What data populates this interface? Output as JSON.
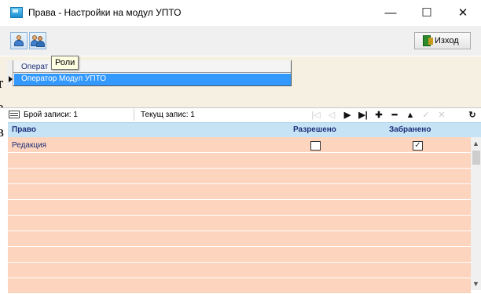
{
  "window": {
    "title": "Права - Настройки на модул УПТО",
    "minimize_glyph": "—",
    "maximize_glyph": "☐",
    "close_glyph": "✕"
  },
  "toolbar": {
    "exit_label": "Изход",
    "tooltip": "Роли"
  },
  "operators_grid": {
    "header": "Операт",
    "selected_row": "Оператор Модул УПТО"
  },
  "navigator": {
    "record_count_label": "Брой записи: 1",
    "current_record_label": "Текущ запис: 1",
    "buttons": {
      "first": "|◁",
      "prior": "◁",
      "next": "▶",
      "last": "▶|",
      "insert": "✚",
      "delete": "━",
      "edit": "▲",
      "post": "✓",
      "cancel": "✕",
      "refresh": "↻"
    }
  },
  "rights_grid": {
    "columns": [
      "Право",
      "Разрешено",
      "Забранено"
    ],
    "rows": [
      {
        "right": "Редакция",
        "allowed": false,
        "forbidden": true
      }
    ],
    "check_glyph": "✓"
  },
  "background_fragments": [
    "т",
    "е",
    "в"
  ],
  "colors": {
    "selected_row": "#3399ff",
    "grid_row": "#fdd4bd",
    "grid_header": "#c6e2f5",
    "upper_panel": "#f5f0e1"
  }
}
